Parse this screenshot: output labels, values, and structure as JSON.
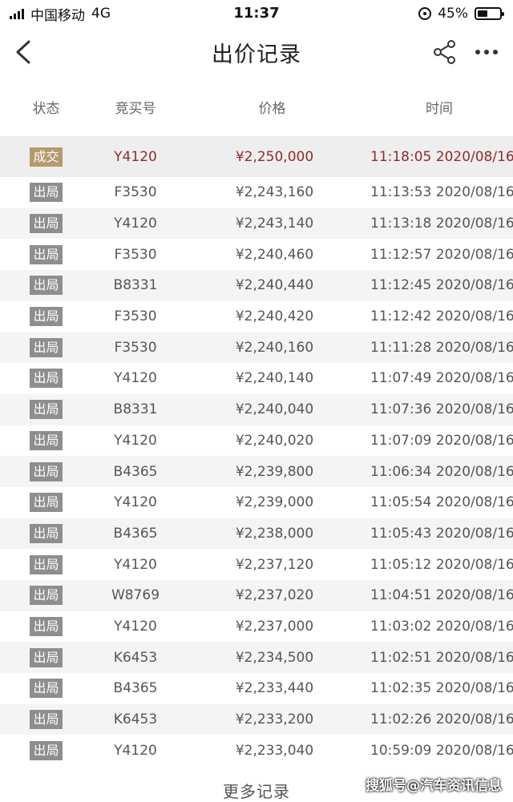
{
  "status_bar": {
    "carrier": "中国移动",
    "network": "4G",
    "time": "11:37",
    "battery": "45%",
    "battery_level": 0.45
  },
  "nav": {
    "title": "出价记录"
  },
  "table": {
    "headers": [
      "状态",
      "竞买号",
      "价格",
      "时间"
    ],
    "rows": [
      {
        "status": "成交",
        "bidder": "Y4120",
        "price": "¥2,250,000",
        "time": "11:18:05 2020/08/16"
      },
      {
        "status": "出局",
        "bidder": "F3530",
        "price": "¥2,243,160",
        "time": "11:13:53 2020/08/16"
      },
      {
        "status": "出局",
        "bidder": "Y4120",
        "price": "¥2,243,140",
        "time": "11:13:18 2020/08/16"
      },
      {
        "status": "出局",
        "bidder": "F3530",
        "price": "¥2,240,460",
        "time": "11:12:57 2020/08/16"
      },
      {
        "status": "出局",
        "bidder": "B8331",
        "price": "¥2,240,440",
        "time": "11:12:45 2020/08/16"
      },
      {
        "status": "出局",
        "bidder": "F3530",
        "price": "¥2,240,420",
        "time": "11:12:42 2020/08/16"
      },
      {
        "status": "出局",
        "bidder": "F3530",
        "price": "¥2,240,160",
        "time": "11:11:28 2020/08/16"
      },
      {
        "status": "出局",
        "bidder": "Y4120",
        "price": "¥2,240,140",
        "time": "11:07:49 2020/08/16"
      },
      {
        "status": "出局",
        "bidder": "B8331",
        "price": "¥2,240,040",
        "time": "11:07:36 2020/08/16"
      },
      {
        "status": "出局",
        "bidder": "Y4120",
        "price": "¥2,240,020",
        "time": "11:07:09 2020/08/16"
      },
      {
        "status": "出局",
        "bidder": "B4365",
        "price": "¥2,239,800",
        "time": "11:06:34 2020/08/16"
      },
      {
        "status": "出局",
        "bidder": "Y4120",
        "price": "¥2,239,000",
        "time": "11:05:54 2020/08/16"
      },
      {
        "status": "出局",
        "bidder": "B4365",
        "price": "¥2,238,000",
        "time": "11:05:43 2020/08/16"
      },
      {
        "status": "出局",
        "bidder": "Y4120",
        "price": "¥2,237,120",
        "time": "11:05:12 2020/08/16"
      },
      {
        "status": "出局",
        "bidder": "W8769",
        "price": "¥2,237,020",
        "time": "11:04:51 2020/08/16"
      },
      {
        "status": "出局",
        "bidder": "Y4120",
        "price": "¥2,237,000",
        "time": "11:03:02 2020/08/16"
      },
      {
        "status": "出局",
        "bidder": "K6453",
        "price": "¥2,234,500",
        "time": "11:02:51 2020/08/16"
      },
      {
        "status": "出局",
        "bidder": "B4365",
        "price": "¥2,233,440",
        "time": "11:02:35 2020/08/16"
      },
      {
        "status": "出局",
        "bidder": "K6453",
        "price": "¥2,233,200",
        "time": "11:02:26 2020/08/16"
      },
      {
        "status": "出局",
        "bidder": "Y4120",
        "price": "¥2,233,040",
        "time": "10:59:09 2020/08/16"
      }
    ]
  },
  "more_label": "更多记录",
  "watermark": "搜狐号@汽车资讯信息",
  "colors": {
    "deal_text": "#8f2b2b",
    "deal_badge": "#b49a6e",
    "out_badge": "#8e8e8e",
    "row_alt": "#f4f4f4"
  },
  "icons": [
    "back-icon",
    "share-icon",
    "more-icon",
    "signal-icon",
    "lock-rotation-icon",
    "battery-icon"
  ]
}
